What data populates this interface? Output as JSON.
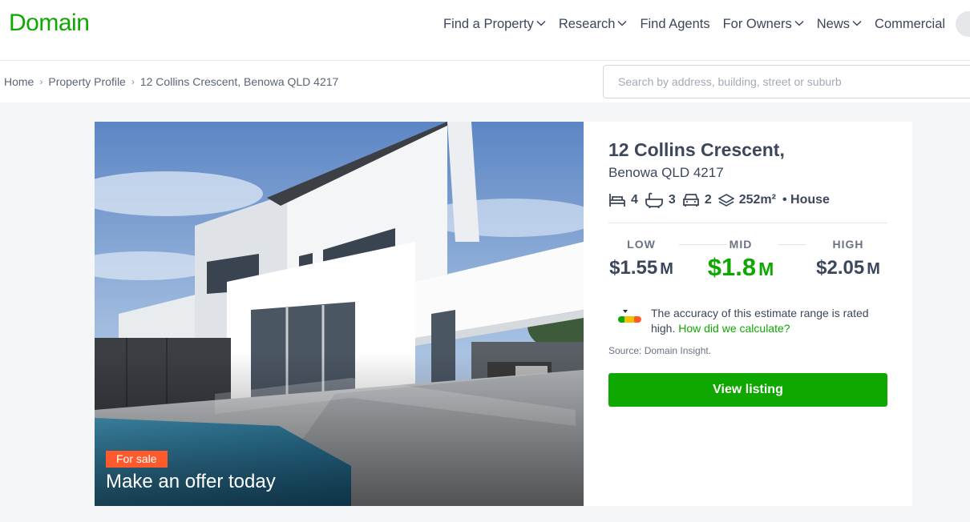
{
  "header": {
    "logo": "Domain",
    "nav": [
      {
        "label": "Find a Property",
        "has_dropdown": true
      },
      {
        "label": "Research",
        "has_dropdown": true
      },
      {
        "label": "Find Agents",
        "has_dropdown": false
      },
      {
        "label": "For Owners",
        "has_dropdown": true
      },
      {
        "label": "News",
        "has_dropdown": true
      },
      {
        "label": "Commercial",
        "has_dropdown": false
      }
    ]
  },
  "breadcrumb": [
    "Home",
    "Property Profile",
    "12 Collins Crescent, Benowa QLD 4217"
  ],
  "search": {
    "placeholder": "Search by address, building, street or suburb",
    "value": ""
  },
  "photo": {
    "badge": "For sale",
    "caption": "Make an offer today"
  },
  "property": {
    "address_line1": "12 Collins Crescent,",
    "address_line2": "Benowa QLD 4217",
    "beds": "4",
    "baths": "3",
    "parking": "2",
    "land": "252m²",
    "type": "• House"
  },
  "estimate": {
    "low_label": "LOW",
    "low_value": "$1.55",
    "low_unit": "M",
    "mid_label": "MID",
    "mid_value": "$1.8",
    "mid_unit": "M",
    "high_label": "HIGH",
    "high_value": "$2.05",
    "high_unit": "M",
    "accuracy_text": "The accuracy of this estimate range is rated high.",
    "accuracy_link": "How did we calculate?",
    "accuracy_level": "high",
    "source": "Source: Domain Insight.",
    "cta": "View listing"
  },
  "colors": {
    "brand": "#0ea800",
    "badge": "#ff5a2c",
    "text": "#3c475b"
  }
}
